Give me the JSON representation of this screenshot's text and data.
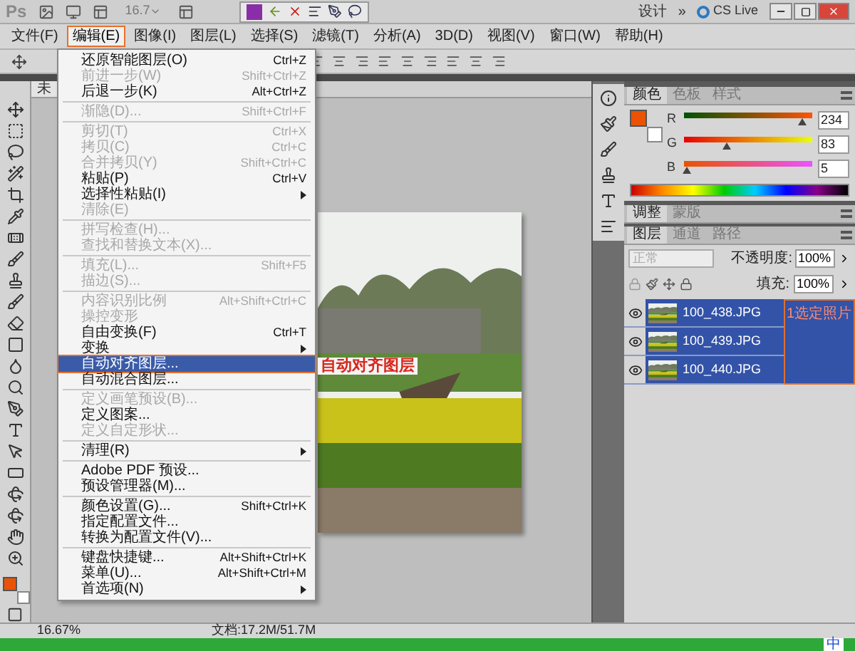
{
  "window": {
    "app_logo": "Ps",
    "zoom": "16.7",
    "workspace": "设计",
    "more": "»",
    "cs_live": "CS Live"
  },
  "menu_bar": [
    {
      "label": "文件(F)",
      "selected": false
    },
    {
      "label": "编辑(E)",
      "selected": true
    },
    {
      "label": "图像(I)",
      "selected": false
    },
    {
      "label": "图层(L)",
      "selected": false
    },
    {
      "label": "选择(S)",
      "selected": false
    },
    {
      "label": "滤镜(T)",
      "selected": false
    },
    {
      "label": "分析(A)",
      "selected": false
    },
    {
      "label": "3D(D)",
      "selected": false
    },
    {
      "label": "视图(V)",
      "selected": false
    },
    {
      "label": "窗口(W)",
      "selected": false
    },
    {
      "label": "帮助(H)",
      "selected": false
    }
  ],
  "edit_menu": {
    "groups": [
      [
        {
          "label": "还原智能图层(O)",
          "shortcut": "Ctrl+Z",
          "disabled": false,
          "submenu": false,
          "selected": false
        },
        {
          "label": "前进一步(W)",
          "shortcut": "Shift+Ctrl+Z",
          "disabled": true,
          "submenu": false,
          "selected": false
        },
        {
          "label": "后退一步(K)",
          "shortcut": "Alt+Ctrl+Z",
          "disabled": false,
          "submenu": false,
          "selected": false
        }
      ],
      [
        {
          "label": "渐隐(D)...",
          "shortcut": "Shift+Ctrl+F",
          "disabled": true,
          "submenu": false,
          "selected": false
        }
      ],
      [
        {
          "label": "剪切(T)",
          "shortcut": "Ctrl+X",
          "disabled": true,
          "submenu": false,
          "selected": false
        },
        {
          "label": "拷贝(C)",
          "shortcut": "Ctrl+C",
          "disabled": true,
          "submenu": false,
          "selected": false
        },
        {
          "label": "合并拷贝(Y)",
          "shortcut": "Shift+Ctrl+C",
          "disabled": true,
          "submenu": false,
          "selected": false
        },
        {
          "label": "粘贴(P)",
          "shortcut": "Ctrl+V",
          "disabled": false,
          "submenu": false,
          "selected": false
        },
        {
          "label": "选择性粘贴(I)",
          "disabled": false,
          "submenu": true,
          "selected": false
        },
        {
          "label": "清除(E)",
          "disabled": true,
          "submenu": false,
          "selected": false
        }
      ],
      [
        {
          "label": "拼写检查(H)...",
          "disabled": true,
          "submenu": false,
          "selected": false
        },
        {
          "label": "查找和替换文本(X)...",
          "disabled": true,
          "submenu": false,
          "selected": false
        }
      ],
      [
        {
          "label": "填充(L)...",
          "shortcut": "Shift+F5",
          "disabled": true,
          "submenu": false,
          "selected": false
        },
        {
          "label": "描边(S)...",
          "disabled": true,
          "submenu": false,
          "selected": false
        }
      ],
      [
        {
          "label": "内容识别比例",
          "shortcut": "Alt+Shift+Ctrl+C",
          "disabled": true,
          "submenu": false,
          "selected": false
        },
        {
          "label": "操控变形",
          "disabled": true,
          "submenu": false,
          "selected": false
        },
        {
          "label": "自由变换(F)",
          "shortcut": "Ctrl+T",
          "disabled": false,
          "submenu": false,
          "selected": false
        },
        {
          "label": "变换",
          "disabled": false,
          "submenu": true,
          "selected": false
        },
        {
          "label": "自动对齐图层...",
          "disabled": false,
          "submenu": false,
          "selected": true
        },
        {
          "label": "自动混合图层...",
          "disabled": false,
          "submenu": false,
          "selected": false
        }
      ],
      [
        {
          "label": "定义画笔预设(B)...",
          "disabled": true,
          "submenu": false,
          "selected": false
        },
        {
          "label": "定义图案...",
          "disabled": false,
          "submenu": false,
          "selected": false
        },
        {
          "label": "定义自定形状...",
          "disabled": true,
          "submenu": false,
          "selected": false
        }
      ],
      [
        {
          "label": "清理(R)",
          "disabled": false,
          "submenu": true,
          "selected": false
        }
      ],
      [
        {
          "label": "Adobe PDF 预设...",
          "disabled": false,
          "submenu": false,
          "selected": false
        },
        {
          "label": "预设管理器(M)...",
          "disabled": false,
          "submenu": false,
          "selected": false
        }
      ],
      [
        {
          "label": "颜色设置(G)...",
          "shortcut": "Shift+Ctrl+K",
          "disabled": false,
          "submenu": false,
          "selected": false
        },
        {
          "label": "指定配置文件...",
          "disabled": false,
          "submenu": false,
          "selected": false
        },
        {
          "label": "转换为配置文件(V)...",
          "disabled": false,
          "submenu": false,
          "selected": false
        }
      ],
      [
        {
          "label": "键盘快捷键...",
          "shortcut": "Alt+Shift+Ctrl+K",
          "disabled": false,
          "submenu": false,
          "selected": false
        },
        {
          "label": "菜单(U)...",
          "shortcut": "Alt+Shift+Ctrl+M",
          "disabled": false,
          "submenu": false,
          "selected": false
        },
        {
          "label": "首选项(N)",
          "disabled": false,
          "submenu": true,
          "selected": false
        }
      ]
    ]
  },
  "document": {
    "tab": "未"
  },
  "color_panel": {
    "tabs": [
      {
        "label": "颜色",
        "selected": true
      },
      {
        "label": "色板",
        "selected": false
      },
      {
        "label": "样式",
        "selected": false
      }
    ],
    "channels": [
      {
        "name": "R",
        "value": "234",
        "level": 0.92
      },
      {
        "name": "G",
        "value": "83",
        "level": 0.33
      },
      {
        "name": "B",
        "value": "5",
        "level": 0.02
      }
    ]
  },
  "adjust_panel": {
    "tabs": [
      {
        "label": "调整",
        "selected": true
      },
      {
        "label": "蒙版",
        "selected": false
      }
    ]
  },
  "layers_panel": {
    "tabs": [
      {
        "label": "图层",
        "selected": true
      },
      {
        "label": "通道",
        "selected": false
      },
      {
        "label": "路径",
        "selected": false
      }
    ],
    "blend_mode": {
      "value": "正常",
      "disabled": true
    },
    "opacity_label": "不透明度:",
    "opacity": "100%",
    "fill_label": "填充:",
    "fill": "100%",
    "layers": [
      {
        "name": "100_438.JPG",
        "visible": true,
        "selected": true
      },
      {
        "name": "100_439.JPG",
        "visible": true,
        "selected": true
      },
      {
        "name": "100_440.JPG",
        "visible": true,
        "selected": true
      }
    ]
  },
  "annotations": [
    {
      "kind": "menu_note",
      "text": "自动对齐图层"
    },
    {
      "kind": "layers_note",
      "text": "1选定照片"
    }
  ],
  "status_bar": {
    "zoom": "16.67%",
    "doc_size": "文档:17.2M/51.7M"
  },
  "taskbar": {
    "ime": "中"
  }
}
